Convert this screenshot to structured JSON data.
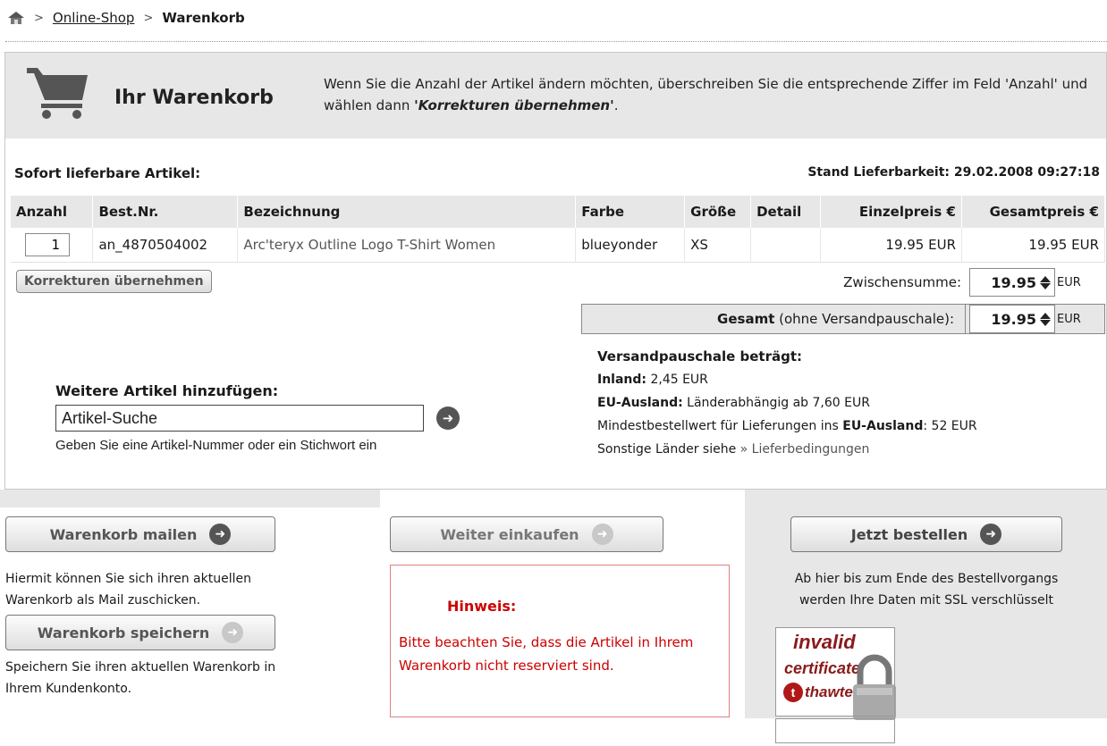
{
  "breadcrumb": {
    "home_icon": "home-icon",
    "sep": ">",
    "shop": "Online-Shop",
    "current": "Warenkorb"
  },
  "header": {
    "title": "Ihr Warenkorb",
    "desc_part1": "Wenn Sie die Anzahl der Artikel ändern möchten, überschreiben Sie die entsprechende Ziffer im Feld 'Anzahl' und wählen dann ",
    "desc_em": "'Korrekturen übernehmen'",
    "desc_end": "."
  },
  "availability": {
    "label": "Sofort lieferbare Artikel:",
    "stand": "Stand Lieferbarkeit: 29.02.2008 09:27:18"
  },
  "table": {
    "headers": [
      "Anzahl",
      "Best.Nr.",
      "Bezeichnung",
      "Farbe",
      "Größe",
      "Detail",
      "Einzelpreis €",
      "Gesamtpreis €"
    ],
    "rows": [
      {
        "qty": "1",
        "nr": "an_4870504002",
        "name": "Arc'teryx Outline Logo T-Shirt Women",
        "farbe": "blueyonder",
        "groesse": "XS",
        "detail": "",
        "einzel": "19.95 EUR",
        "gesamt": "19.95 EUR"
      }
    ]
  },
  "korrekturen_label": "Korrekturen übernehmen",
  "totals": {
    "zwischen_label": "Zwischensumme:",
    "zwischen_value": "19.95",
    "gesamt_bold": "Gesamt",
    "gesamt_rest": " (ohne Versandpauschale):",
    "gesamt_value": "19.95",
    "currency": "EUR"
  },
  "versand": {
    "title": "Versandpauschale beträgt:",
    "inland_label": "Inland:",
    "inland_value": " 2,45 EUR",
    "eu_label": "EU-Ausland:",
    "eu_value": " Länderabhängig ab 7,60 EUR",
    "min_pre": "Mindestbestellwert für Lieferungen ins ",
    "min_bold": "EU-Ausland",
    "min_post": ": 52 EUR",
    "other_pre": "Sonstige Länder siehe ",
    "other_link": "» Lieferbedingungen"
  },
  "search": {
    "title": "Weitere Artikel hinzufügen:",
    "value": "Artikel-Suche",
    "hint": "Geben Sie eine Artikel-Nummer oder ein Stichwort ein"
  },
  "actions": {
    "mail_label": "Warenkorb mailen",
    "mail_text_1": "Hiermit können Sie sich ihren aktuellen",
    "mail_text_2": "Warenkorb als Mail zuschicken.",
    "save_label": "Warenkorb speichern",
    "save_text_1": "Speichern Sie ihren aktuellen Warenkorb in",
    "save_text_2": "Ihrem Kundenkonto.",
    "weiter_label": "Weiter einkaufen",
    "bestellen_label": "Jetzt bestellen",
    "ssl_1": "Ab hier bis zum Ende des Bestellvorgangs",
    "ssl_2": "werden Ihre Daten mit SSL verschlüsselt"
  },
  "hinweis": {
    "title": "Hinweis:",
    "text": "Bitte beachten Sie, dass die Artikel in Ihrem Warenkorb nicht reserviert sind."
  },
  "cert": {
    "invalid": "invalid",
    "certificate": "certificate",
    "thawte": "thawte",
    "t": "t"
  },
  "colors": {
    "band": "#e7e7e7",
    "hinweis_red": "#cc0000",
    "icon_dark": "#555555"
  }
}
